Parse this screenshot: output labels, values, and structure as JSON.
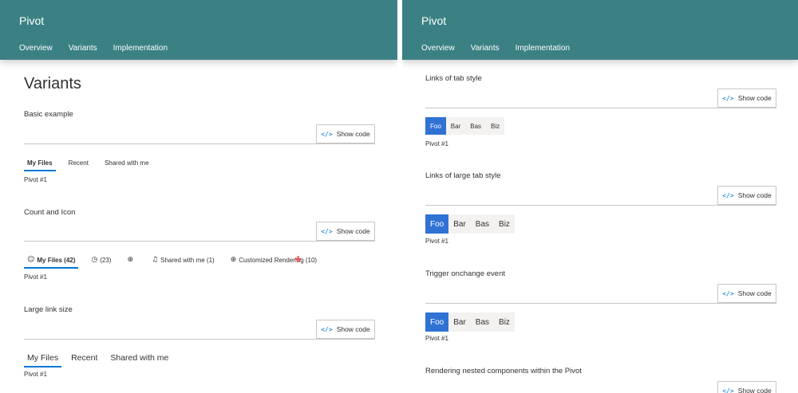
{
  "left": {
    "header": {
      "title": "Pivot",
      "nav": [
        "Overview",
        "Variants",
        "Implementation"
      ]
    },
    "page_title": "Variants",
    "show_code_label": "Show code",
    "sections": {
      "basic": {
        "label": "Basic example",
        "links": [
          "My Files",
          "Recent",
          "Shared with me"
        ],
        "content": "Pivot #1"
      },
      "count_icon": {
        "label": "Count and Icon",
        "links": [
          {
            "icon": "smiley-icon",
            "glyph": "☺",
            "text": "My Files (42)"
          },
          {
            "icon": "clock-icon",
            "glyph": "◷",
            "text": "(23)"
          },
          {
            "icon": "globe-icon",
            "glyph": "⊕",
            "text": ""
          },
          {
            "icon": "bell-icon",
            "glyph": "♫",
            "text": "Shared with me (1)"
          },
          {
            "icon": "globe-icon",
            "glyph": "⊕",
            "text": "Customized Rendering (10)"
          }
        ],
        "content": "Pivot #1"
      },
      "large": {
        "label": "Large link size",
        "links": [
          "My Files",
          "Recent",
          "Shared with me"
        ],
        "content": "Pivot #1"
      }
    }
  },
  "right": {
    "header": {
      "title": "Pivot",
      "nav": [
        "Overview",
        "Variants",
        "Implementation"
      ]
    },
    "show_code_label": "Show code",
    "sections": {
      "tab_style": {
        "label": "Links of tab style",
        "tabs": [
          "Foo",
          "Bar",
          "Bas",
          "Biz"
        ],
        "content": "Pivot #1"
      },
      "large_tab_style": {
        "label": "Links of large tab style",
        "tabs": [
          "Foo",
          "Bar",
          "Bas",
          "Biz"
        ],
        "content": "Pivot #1"
      },
      "onchange": {
        "label": "Trigger onchange event",
        "tabs": [
          "Foo",
          "Bar",
          "Bas",
          "Biz"
        ],
        "content": "Pivot #1"
      },
      "nested": {
        "label": "Rendering nested components within the Pivot"
      }
    }
  },
  "icons": {
    "code": "</>",
    "cursor": "✚"
  },
  "colors": {
    "header": "#3b8183",
    "accent": "#0078d4",
    "tab_selected": "#2f72d4",
    "tab_bg": "#f3f2f1"
  }
}
